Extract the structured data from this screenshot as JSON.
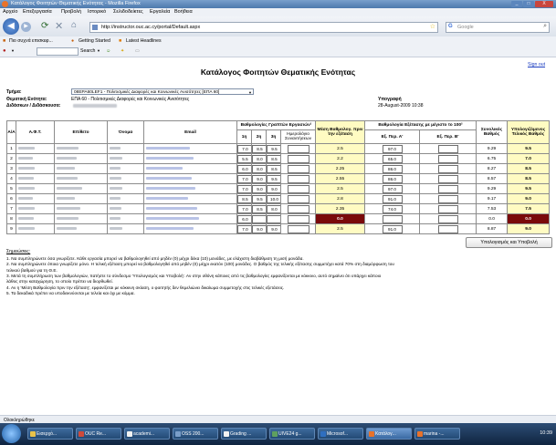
{
  "window": {
    "title": "Κατάλογος Φοιτητών Θεματικής Ενότητας - Mozilla Firefox",
    "min": "_",
    "max": "□",
    "close": "X"
  },
  "menu": [
    "Αρχείο",
    "Επεξεργασία",
    "Προβολή",
    "Ιστορικό",
    "Σελιδοδείκτες",
    "Εργαλεία",
    "Βοήθεια"
  ],
  "nav": {
    "url": "http://instructor.ouc.ac.cy/portal/Default.aspx",
    "search_placeholder": "Google"
  },
  "bookmarks": [
    "Πιο συχνά επισκεφ...",
    "Getting Started",
    "Latest Headlines"
  ],
  "toolbar2": {
    "search_label": "Search"
  },
  "page": {
    "signout": "Sign out",
    "title": "Κατάλογος Φοιτητών Θεματικής Ενότητας",
    "labels": {
      "tmima": "Τμήμα:",
      "thematiki": "Θεματική Ενότητα:",
      "didaskon": "Διδάσκων / Διδάσκουσα:",
      "ypografi": "Υπογραφή"
    },
    "tmima_value": "08EPA60LEF1 - Πολιτισμικές Διαφορές και Κοινωνικές Ανισότητες [ΕΠΑ 60]",
    "thematiki_value": "ΕΠΑ 60 - Πολιτισμικές Διαφορές και Κοινωνικές Ανισότητες",
    "date": "28-August-2009 10:38"
  },
  "table": {
    "headers": {
      "aa": "Α/Α",
      "afm": "Α.Φ.Τ.",
      "eponymo": "Επίθετο",
      "onoma": "Όνομα",
      "email": "Email",
      "ergasies_group": "Βαθμολογίες Γραπτών Εργασιών¹",
      "e1": "1η",
      "e2": "2η",
      "e3": "3η",
      "imerologio": "Ημερολόγιο Συναντήσεων",
      "mesi": "Μέση Βαθμολογ. πριν την εξέταση",
      "exetaseis_group": "Βαθμολογία Εξέτασης με μέγιστο το 100²",
      "perA": "Εξ. Περ. Α'",
      "perB": "Εξ. Περ. Β'",
      "synolikos": "Συνολικός Βαθμός",
      "telikos": "Υπολογιζόμενος Τελικός Βαθμός"
    },
    "rows": [
      {
        "aa": "1",
        "e1": "7.0",
        "e2": "8.5",
        "e3": "9.5",
        "mesi": "2.5",
        "perA": "97.0",
        "synolikos": "9.29",
        "telikos": "9.5",
        "red": false
      },
      {
        "aa": "2",
        "e1": "5.5",
        "e2": "8.0",
        "e3": "8.5",
        "mesi": "2.2",
        "perA": "65.0",
        "synolikos": "6.75",
        "telikos": "7.0",
        "red": false
      },
      {
        "aa": "3",
        "e1": "6.0",
        "e2": "8.0",
        "e3": "8.5",
        "mesi": "2.25",
        "perA": "86.0",
        "synolikos": "8.27",
        "telikos": "8.5",
        "red": false
      },
      {
        "aa": "4",
        "e1": "7.0",
        "e2": "9.0",
        "e3": "9.5",
        "mesi": "2.55",
        "perA": "86.0",
        "synolikos": "8.57",
        "telikos": "8.5",
        "red": false
      },
      {
        "aa": "5",
        "e1": "7.0",
        "e2": "9.0",
        "e3": "9.0",
        "mesi": "2.5",
        "perA": "97.0",
        "synolikos": "9.29",
        "telikos": "9.5",
        "red": false
      },
      {
        "aa": "6",
        "e1": "8.5",
        "e2": "9.5",
        "e3": "10.0",
        "mesi": "2.8",
        "perA": "91.0",
        "synolikos": "9.17",
        "telikos": "9.0",
        "red": false
      },
      {
        "aa": "7",
        "e1": "7.0",
        "e2": "8.5",
        "e3": "8.0",
        "mesi": "2.35",
        "perA": "74.0",
        "synolikos": "7.53",
        "telikos": "7.5",
        "red": false
      },
      {
        "aa": "8",
        "e1": "6.0",
        "e2": "",
        "e3": "",
        "mesi": "0.0",
        "perA": "",
        "synolikos": "0.0",
        "telikos": "0.0",
        "red": true
      },
      {
        "aa": "9",
        "e1": "7.0",
        "e2": "9.0",
        "e3": "9.0",
        "mesi": "2.5",
        "perA": "91.0",
        "synolikos": "8.87",
        "telikos": "9.0",
        "red": false
      }
    ]
  },
  "calc_button": "Υπολογισμός και Υποβολή",
  "notes_title": "Σημειώσεις:",
  "notes": [
    "1. Να συμπληρώνετε όσα γνωρίζετε. Κάθε εργασία μπορεί να βαθμολογηθεί από μηδέν (0) μέχρι δέκα (10) μονάδες, με ελάχιστη διαβάθμιση τη μισή μονάδα.",
    "2. Να συμπληρώνετε όποια γνωρίζετε μόνο. Η τελική εξέταση μπορεί να βαθμολογηθεί από μηδέν (0) μέχρι εκατόν (100) μονάδες. Ο βαθμός της τελικής εξέτασης συμμετέχει κατά 70% στη διαμόρφωση του",
    "   τελικού βαθμού για τη Θ.Ε.",
    "3. Μετά τη συμπλήρωση των βαθμολογιών, πατήστε το σύνδεσμο 'Υπολογισμός και Υποβολή'. Αν στην οθόνη κάποιες από τις βαθμολογίες εμφανίζονται με κόκκινο, αυτό σημαίνει ότι υπάρχει κάποιο",
    "   λάθος στην καταχώρηση, το οποίο πρέπει να διορθωθεί.",
    "4. Αν η 'Μέση Βαθμολογία πριν την εξέταση', εμφανίζεται με κόκκινη σκίαση, ο φοιτητής δεν θεμελιώνει δικαίωμα συμμετοχής στις τελικές εξετάσεις.",
    "5. Τα δεκαδικά πρέπει να υποδεικνύονται με τελεία και όχι με κόμμα."
  ],
  "status": "Ολοκληρώθηκε",
  "taskbar": {
    "tasks": [
      "Εισερχό...",
      "OUC Re...",
      "academi...",
      "OSS 200...",
      "Grading ...",
      "UIVE24 g...",
      "Microsof...",
      "Κατάλογ...",
      "marina -..."
    ],
    "clock": "10:39"
  }
}
